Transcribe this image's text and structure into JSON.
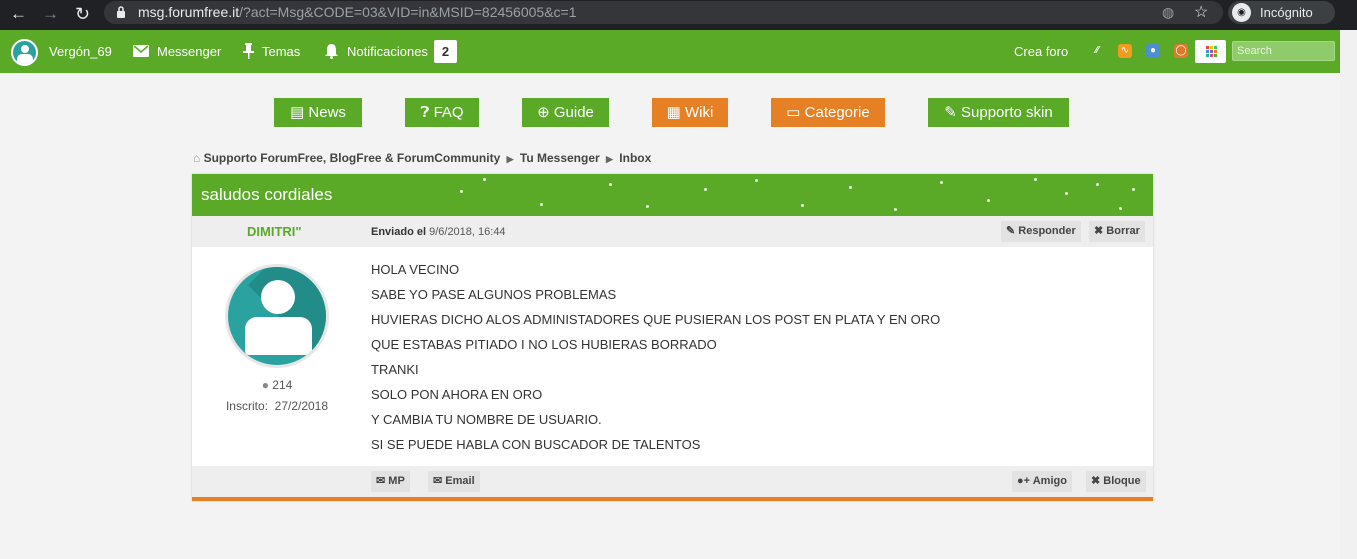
{
  "browser": {
    "url_host": "msg.forumfree.it",
    "url_path": "/?act=Msg&CODE=03&VID=in&MSID=82456005&c=1",
    "incognito_label": "Incógnito"
  },
  "topbar": {
    "username": "Vergón_69",
    "messenger": "Messenger",
    "temas": "Temas",
    "notifications": "Notificaciones",
    "notifications_count": "2",
    "create_forum": "Crea foro",
    "search_placeholder": "Search"
  },
  "menu": {
    "news": "News",
    "faq": "FAQ",
    "guide": "Guide",
    "wiki": "Wiki",
    "categorie": "Categorie",
    "supporto": "Supporto skin"
  },
  "breadcrumb": {
    "forum": "Supporto ForumFree, BlogFree & ForumCommunity",
    "messenger": "Tu Messenger",
    "inbox": "Inbox"
  },
  "message": {
    "title": "saludos cordiales",
    "author": "DIMITRI\"",
    "sent_label": "Enviado el",
    "sent_date": "9/6/2018, 16:44",
    "reply_label": "Responder",
    "delete_label": "Borrar",
    "post_count": "214",
    "registered_label": "Inscrito:",
    "registered_date": "27/2/2018",
    "lines": [
      "HOLA VECINO",
      "SABE YO PASE ALGUNOS PROBLEMAS",
      "HUVIERAS DICHO ALOS ADMINISTADORES QUE PUSIERAN LOS POST EN PLATA Y EN ORO",
      "QUE ESTABAS PITIADO I NO LOS HUBIERAS BORRADO",
      "TRANKI",
      "SOLO PON AHORA EN ORO",
      "Y CAMBIA TU NOMBRE DE USUARIO.",
      "SI SE PUEDE HABLA CON BUSCADOR DE TALENTOS"
    ],
    "mp_label": "MP",
    "email_label": "Email",
    "friend_label": "Amigo",
    "block_label": "Bloque"
  },
  "colors": {
    "brand_green": "#5aaa27",
    "accent_orange": "#e58024"
  }
}
